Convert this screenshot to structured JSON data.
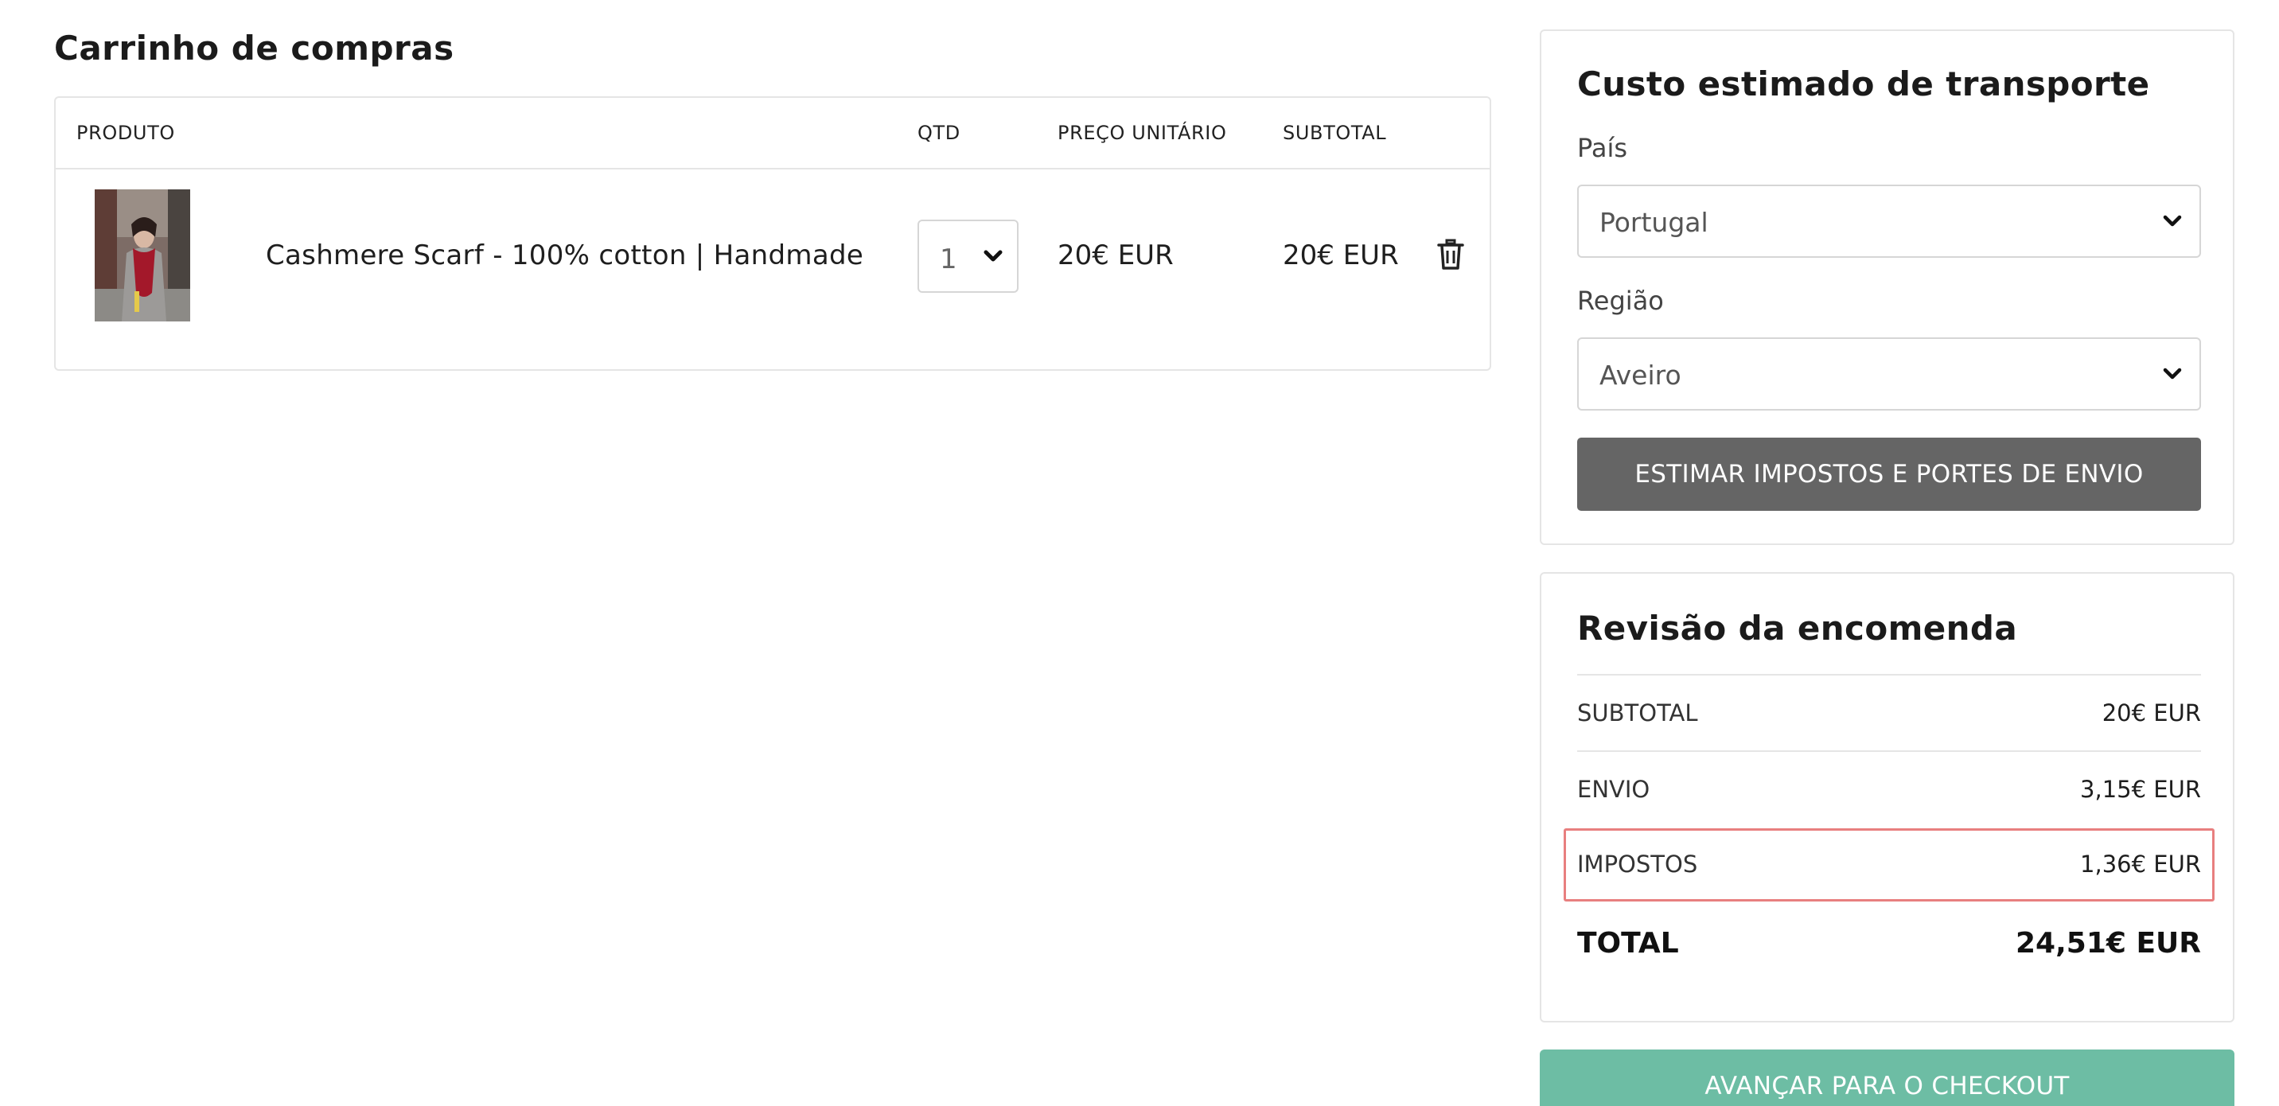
{
  "cart": {
    "title": "Carrinho de compras",
    "columns": {
      "product": "PRODUTO",
      "qty": "QTD",
      "unit_price": "PREÇO UNITÁRIO",
      "subtotal": "SUBTOTAL"
    },
    "items": [
      {
        "name": "Cashmere Scarf - 100% cotton | Handmade",
        "qty": "1",
        "unit_price": "20€ EUR",
        "subtotal": "20€ EUR",
        "image_icon": "product-photo",
        "delete_icon": "trash-icon"
      }
    ]
  },
  "shipping": {
    "title": "Custo estimado de transporte",
    "country_label": "País",
    "country_value": "Portugal",
    "region_label": "Região",
    "region_value": "Aveiro",
    "estimate_button": "ESTIMAR IMPOSTOS E PORTES DE ENVIO"
  },
  "review": {
    "title": "Revisão da encomenda",
    "rows": [
      {
        "label": "SUBTOTAL",
        "value": "20€ EUR"
      },
      {
        "label": "ENVIO",
        "value": "3,15€ EUR"
      },
      {
        "label": "IMPOSTOS",
        "value": "1,36€ EUR"
      }
    ],
    "total_label": "TOTAL",
    "total_value": "24,51€ EUR"
  },
  "checkout_button": "AVANÇAR PARA O CHECKOUT",
  "colors": {
    "estimate_button_bg": "#656565",
    "checkout_button_bg": "#6dbda4",
    "highlight_border": "#e87f7f",
    "border": "#e5e5e5"
  }
}
